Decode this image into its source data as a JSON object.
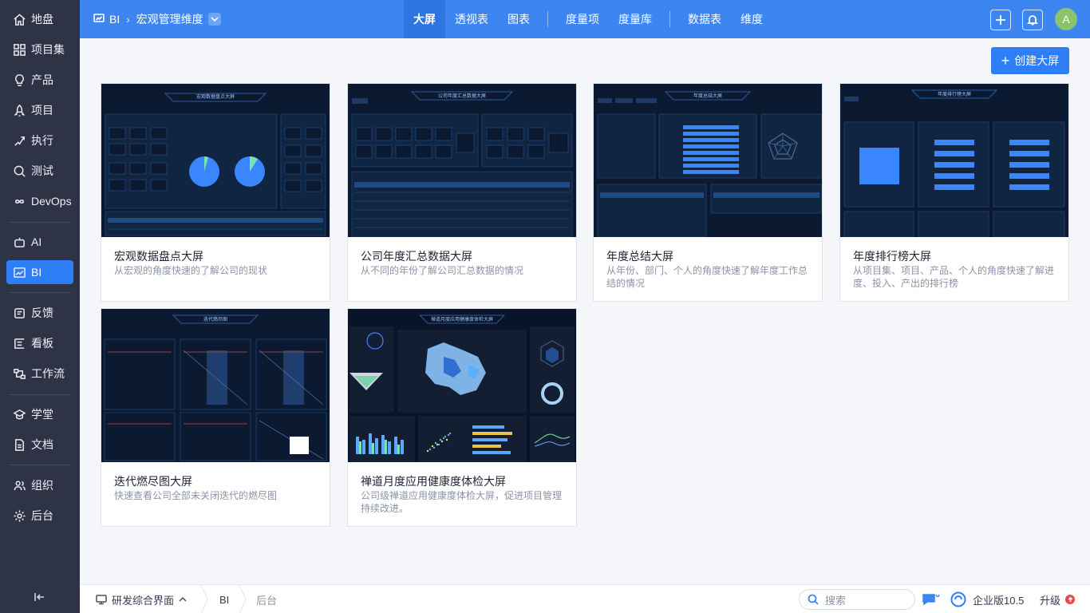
{
  "sidebar": {
    "items": [
      {
        "label": "地盘",
        "icon": "home-icon"
      },
      {
        "label": "项目集",
        "icon": "grid-icon"
      },
      {
        "label": "产品",
        "icon": "lightbulb-icon"
      },
      {
        "label": "项目",
        "icon": "rocket-icon"
      },
      {
        "label": "执行",
        "icon": "run-icon"
      },
      {
        "label": "测试",
        "icon": "search-bug-icon"
      },
      {
        "label": "DevOps",
        "icon": "infinity-icon"
      },
      {
        "label": "AI",
        "icon": "robot-icon"
      },
      {
        "label": "BI",
        "icon": "chart-icon"
      },
      {
        "label": "反馈",
        "icon": "feedback-icon"
      },
      {
        "label": "看板",
        "icon": "kanban-icon"
      },
      {
        "label": "工作流",
        "icon": "workflow-icon"
      },
      {
        "label": "学堂",
        "icon": "school-icon"
      },
      {
        "label": "文档",
        "icon": "document-icon"
      },
      {
        "label": "组织",
        "icon": "people-icon"
      },
      {
        "label": "后台",
        "icon": "gear-icon"
      }
    ],
    "active": "BI"
  },
  "header": {
    "module": "BI",
    "breadcrumb_current": "宏观管理维度",
    "tabs": [
      "大屏",
      "透视表",
      "图表",
      "度量项",
      "度量库",
      "数据表",
      "维度"
    ],
    "active_tab": "大屏",
    "avatar_letter": "A"
  },
  "main": {
    "create_button": "创建大屏",
    "cards": [
      {
        "title": "宏观数据盘点大屏",
        "desc": "从宏观的角度快速的了解公司的现状",
        "thumb_heading": "宏观数据盘点大屏"
      },
      {
        "title": "公司年度汇总数据大屏",
        "desc": "从不同的年份了解公司汇总数据的情况",
        "thumb_heading": "公司年度汇总数据大屏"
      },
      {
        "title": "年度总结大屏",
        "desc": "从年份、部门、个人的角度快速了解年度工作总结的情况",
        "thumb_heading": "年度总结大屏"
      },
      {
        "title": "年度排行榜大屏",
        "desc": "从项目集、项目、产品、个人的角度快速了解进度、投入、产出的排行榜",
        "thumb_heading": "年度排行榜大屏"
      },
      {
        "title": "迭代燃尽图大屏",
        "desc": "快速查看公司全部未关闭迭代的燃尽图",
        "thumb_heading": "迭代燃尽图"
      },
      {
        "title": "禅道月度应用健康度体检大屏",
        "desc": "公司级禅道应用健康度体检大屏，促进项目管理持续改进。",
        "thumb_heading": "禅道月度应用健康度体检大屏"
      }
    ]
  },
  "footer": {
    "workspace": "研发综合界面",
    "crumb1": "BI",
    "crumb2": "后台",
    "search_placeholder": "搜索",
    "version": "企业版10.5",
    "upgrade": "升级"
  },
  "colors": {
    "accent": "#2e7ff5",
    "header": "#3d85f0",
    "sidebar": "#2e3446",
    "thumb_bg": "#0c1b33"
  }
}
